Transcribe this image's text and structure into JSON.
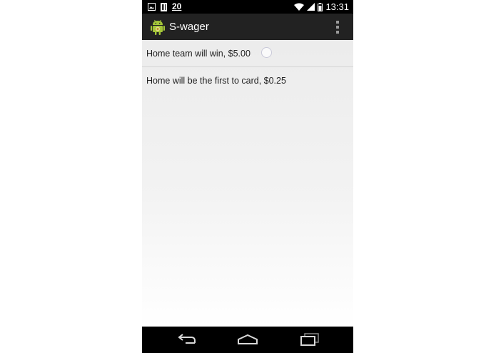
{
  "status_bar": {
    "notification_count": "20",
    "clock": "13:31",
    "left_icons": [
      "image-icon",
      "sim-icon"
    ],
    "right_icons": [
      "wifi-icon",
      "signal-icon",
      "battery-icon"
    ]
  },
  "action_bar": {
    "title": "S-wager",
    "app_icon": "android-app-icon",
    "overflow_icon": "overflow-menu-icon"
  },
  "bets": [
    {
      "label": "Home team will win, $5.00",
      "has_radio": true,
      "selected": false
    },
    {
      "label": "Home will be the first to card, $0.25",
      "has_radio": false
    }
  ],
  "nav_bar": {
    "icons": [
      "back-icon",
      "home-icon",
      "recent-apps-icon"
    ]
  },
  "colors": {
    "status_bar": "#000000",
    "action_bar": "#222222",
    "content_bg": "#f0f0f0",
    "android_green": "#a4c639"
  }
}
